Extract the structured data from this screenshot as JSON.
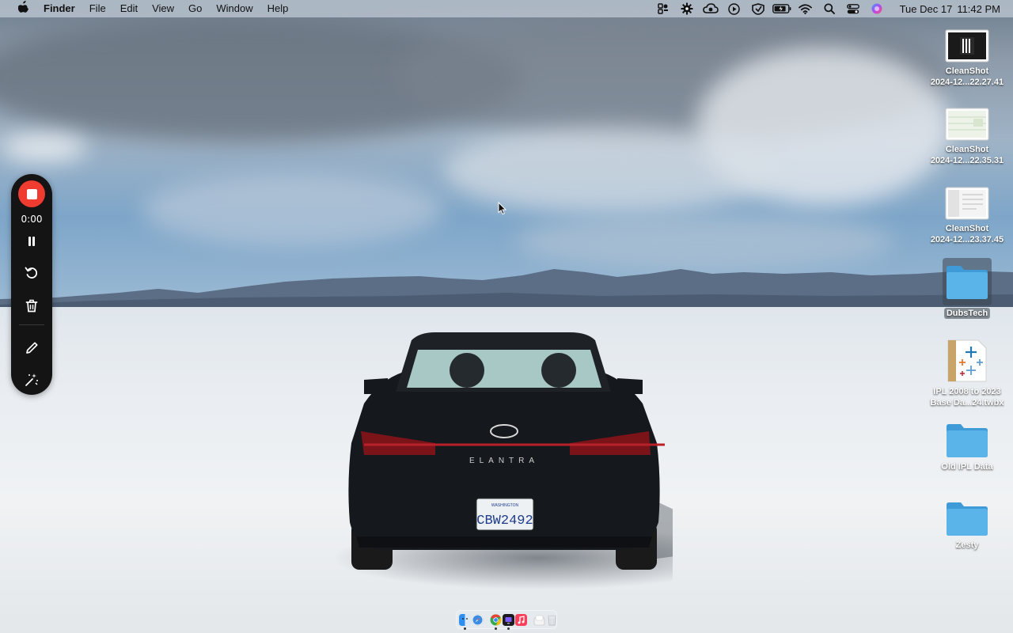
{
  "menubar": {
    "apple_icon": "apple-logo",
    "app_name": "Finder",
    "menus": [
      "File",
      "Edit",
      "View",
      "Go",
      "Window",
      "Help"
    ],
    "tray_icons": [
      "figma-icon",
      "gear-star-icon",
      "cloud-sync-icon",
      "play-circle-icon",
      "shield-icon",
      "battery-icon",
      "wifi-icon",
      "search-icon",
      "control-center-icon",
      "siri-icon"
    ],
    "clock": {
      "date": "Tue Dec 17",
      "time": "11:42 PM"
    }
  },
  "recording_toolbar": {
    "timer": "0:00",
    "tools": [
      "stop-icon",
      "pause-icon",
      "restart-icon",
      "trash-icon",
      "pencil-icon",
      "magic-wand-icon"
    ],
    "stop_color": "#ef3b30"
  },
  "desktop_icons": [
    {
      "kind": "screenshot",
      "line1": "CleanShot",
      "line2": "2024-12...22.27.41"
    },
    {
      "kind": "screenshot",
      "line1": "CleanShot",
      "line2": "2024-12...22.35.31"
    },
    {
      "kind": "screenshot",
      "line1": "CleanShot",
      "line2": "2024-12...23.37.45"
    },
    {
      "kind": "folder",
      "line1": "DubsTech",
      "selected": true
    },
    {
      "kind": "tableau-file",
      "line1": "IPL 2008 to 2023",
      "line2": "Base Da...24.twbx"
    },
    {
      "kind": "folder",
      "line1": "Old IPL Data"
    },
    {
      "kind": "folder",
      "line1": "Zesty"
    }
  ],
  "wallpaper": {
    "car_badge": "ELANTRA",
    "plate": "CBW2492",
    "plate_state": "WASHINGTON"
  },
  "dock": {
    "apps": [
      "finder-icon",
      "safari-icon",
      "chrome-icon",
      "tv-icon",
      "music-icon",
      "documents-icon",
      "trash-icon"
    ]
  },
  "colors": {
    "folder_blue": "#5ab4ea",
    "menubar": "#b9c3d0"
  }
}
